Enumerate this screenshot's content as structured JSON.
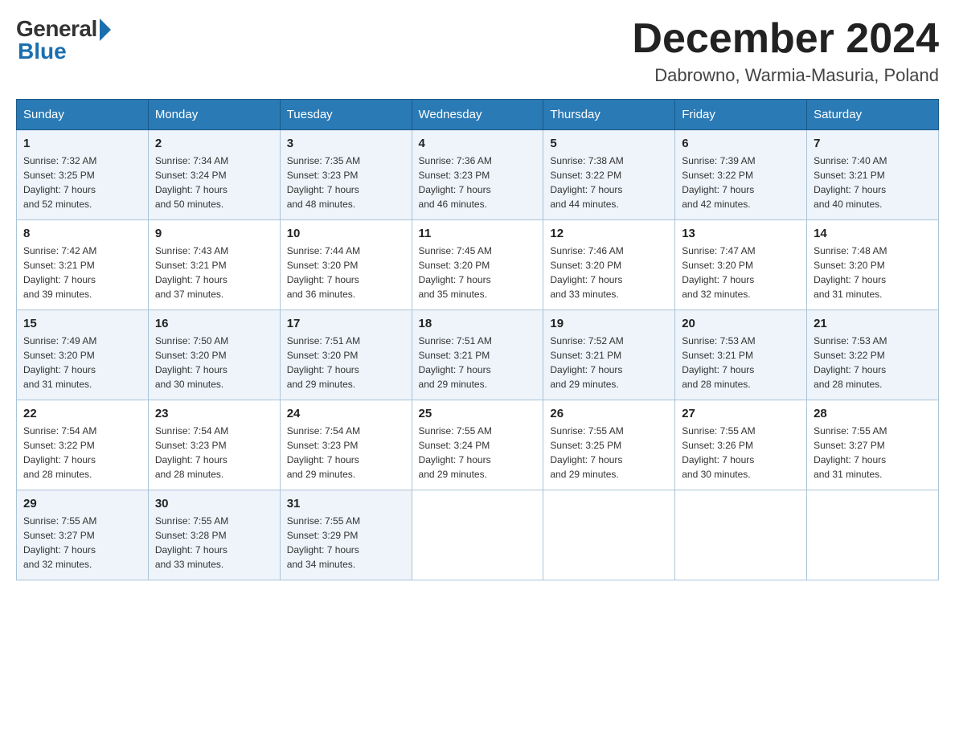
{
  "logo": {
    "general": "General",
    "blue": "Blue"
  },
  "title": {
    "month": "December 2024",
    "location": "Dabrowno, Warmia-Masuria, Poland"
  },
  "weekdays": [
    "Sunday",
    "Monday",
    "Tuesday",
    "Wednesday",
    "Thursday",
    "Friday",
    "Saturday"
  ],
  "weeks": [
    [
      {
        "day": "1",
        "sunrise": "7:32 AM",
        "sunset": "3:25 PM",
        "daylight": "7 hours and 52 minutes."
      },
      {
        "day": "2",
        "sunrise": "7:34 AM",
        "sunset": "3:24 PM",
        "daylight": "7 hours and 50 minutes."
      },
      {
        "day": "3",
        "sunrise": "7:35 AM",
        "sunset": "3:23 PM",
        "daylight": "7 hours and 48 minutes."
      },
      {
        "day": "4",
        "sunrise": "7:36 AM",
        "sunset": "3:23 PM",
        "daylight": "7 hours and 46 minutes."
      },
      {
        "day": "5",
        "sunrise": "7:38 AM",
        "sunset": "3:22 PM",
        "daylight": "7 hours and 44 minutes."
      },
      {
        "day": "6",
        "sunrise": "7:39 AM",
        "sunset": "3:22 PM",
        "daylight": "7 hours and 42 minutes."
      },
      {
        "day": "7",
        "sunrise": "7:40 AM",
        "sunset": "3:21 PM",
        "daylight": "7 hours and 40 minutes."
      }
    ],
    [
      {
        "day": "8",
        "sunrise": "7:42 AM",
        "sunset": "3:21 PM",
        "daylight": "7 hours and 39 minutes."
      },
      {
        "day": "9",
        "sunrise": "7:43 AM",
        "sunset": "3:21 PM",
        "daylight": "7 hours and 37 minutes."
      },
      {
        "day": "10",
        "sunrise": "7:44 AM",
        "sunset": "3:20 PM",
        "daylight": "7 hours and 36 minutes."
      },
      {
        "day": "11",
        "sunrise": "7:45 AM",
        "sunset": "3:20 PM",
        "daylight": "7 hours and 35 minutes."
      },
      {
        "day": "12",
        "sunrise": "7:46 AM",
        "sunset": "3:20 PM",
        "daylight": "7 hours and 33 minutes."
      },
      {
        "day": "13",
        "sunrise": "7:47 AM",
        "sunset": "3:20 PM",
        "daylight": "7 hours and 32 minutes."
      },
      {
        "day": "14",
        "sunrise": "7:48 AM",
        "sunset": "3:20 PM",
        "daylight": "7 hours and 31 minutes."
      }
    ],
    [
      {
        "day": "15",
        "sunrise": "7:49 AM",
        "sunset": "3:20 PM",
        "daylight": "7 hours and 31 minutes."
      },
      {
        "day": "16",
        "sunrise": "7:50 AM",
        "sunset": "3:20 PM",
        "daylight": "7 hours and 30 minutes."
      },
      {
        "day": "17",
        "sunrise": "7:51 AM",
        "sunset": "3:20 PM",
        "daylight": "7 hours and 29 minutes."
      },
      {
        "day": "18",
        "sunrise": "7:51 AM",
        "sunset": "3:21 PM",
        "daylight": "7 hours and 29 minutes."
      },
      {
        "day": "19",
        "sunrise": "7:52 AM",
        "sunset": "3:21 PM",
        "daylight": "7 hours and 29 minutes."
      },
      {
        "day": "20",
        "sunrise": "7:53 AM",
        "sunset": "3:21 PM",
        "daylight": "7 hours and 28 minutes."
      },
      {
        "day": "21",
        "sunrise": "7:53 AM",
        "sunset": "3:22 PM",
        "daylight": "7 hours and 28 minutes."
      }
    ],
    [
      {
        "day": "22",
        "sunrise": "7:54 AM",
        "sunset": "3:22 PM",
        "daylight": "7 hours and 28 minutes."
      },
      {
        "day": "23",
        "sunrise": "7:54 AM",
        "sunset": "3:23 PM",
        "daylight": "7 hours and 28 minutes."
      },
      {
        "day": "24",
        "sunrise": "7:54 AM",
        "sunset": "3:23 PM",
        "daylight": "7 hours and 29 minutes."
      },
      {
        "day": "25",
        "sunrise": "7:55 AM",
        "sunset": "3:24 PM",
        "daylight": "7 hours and 29 minutes."
      },
      {
        "day": "26",
        "sunrise": "7:55 AM",
        "sunset": "3:25 PM",
        "daylight": "7 hours and 29 minutes."
      },
      {
        "day": "27",
        "sunrise": "7:55 AM",
        "sunset": "3:26 PM",
        "daylight": "7 hours and 30 minutes."
      },
      {
        "day": "28",
        "sunrise": "7:55 AM",
        "sunset": "3:27 PM",
        "daylight": "7 hours and 31 minutes."
      }
    ],
    [
      {
        "day": "29",
        "sunrise": "7:55 AM",
        "sunset": "3:27 PM",
        "daylight": "7 hours and 32 minutes."
      },
      {
        "day": "30",
        "sunrise": "7:55 AM",
        "sunset": "3:28 PM",
        "daylight": "7 hours and 33 minutes."
      },
      {
        "day": "31",
        "sunrise": "7:55 AM",
        "sunset": "3:29 PM",
        "daylight": "7 hours and 34 minutes."
      },
      null,
      null,
      null,
      null
    ]
  ],
  "labels": {
    "sunrise": "Sunrise:",
    "sunset": "Sunset:",
    "daylight": "Daylight:"
  }
}
